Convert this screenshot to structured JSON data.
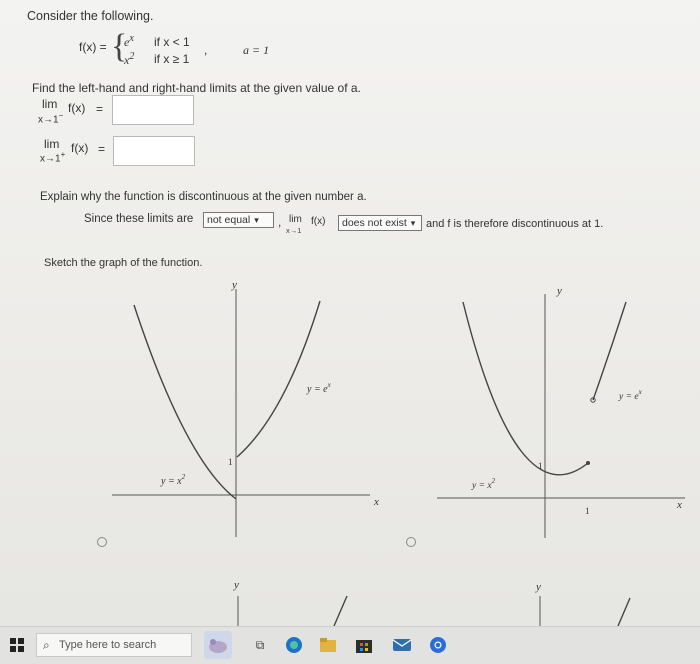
{
  "problem": {
    "intro": "Consider the following.",
    "function_name": "f(x) =",
    "case1_expr": "e",
    "case1_exp": "x",
    "case1_cond": "if x < 1",
    "case2_expr": "x",
    "case2_exp": "2",
    "case2_cond": "if x ≥ 1",
    "comma": ",",
    "a_value": "a = 1",
    "instruction": "Find the left-hand and right-hand limits at the given value of a."
  },
  "limits": {
    "left": {
      "lim": "lim",
      "sub": "x→1",
      "sup": "−",
      "expr": "f(x)",
      "eq": "=",
      "answer": ""
    },
    "right": {
      "lim": "lim",
      "sub": "x→1",
      "sup": "+",
      "expr": "f(x)",
      "eq": "=",
      "answer": ""
    }
  },
  "explain": {
    "prompt": "Explain why the function is discontinuous at the given number a.",
    "lead": "Since these limits are",
    "select1": "not equal",
    "comma": ",",
    "lim": "lim",
    "lim_sub": "x→1",
    "lim_expr": "f(x)",
    "select2": "does not exist",
    "tail": "and f is therefore discontinuous at 1."
  },
  "sketch": {
    "prompt": "Sketch the graph of the function.",
    "graph1": {
      "y_label": "y",
      "x_label": "x",
      "ex_label": "y = e",
      "ex_exp": "x",
      "x2_label": "y = x",
      "x2_exp": "2",
      "tick": "1"
    },
    "graph2": {
      "y_label": "y",
      "x_label": "x",
      "ex_label": "y = e",
      "ex_exp": "x",
      "x2_label": "y = x",
      "x2_exp": "2",
      "tick_y": "1",
      "tick_x": "1"
    },
    "graph3": {
      "y_label": "y"
    },
    "graph4": {
      "y_label": "y"
    }
  },
  "taskbar": {
    "search_placeholder": "Type here to search"
  },
  "colors": {
    "curve": "#444444",
    "taskbar_blue": "#1e73c8"
  }
}
